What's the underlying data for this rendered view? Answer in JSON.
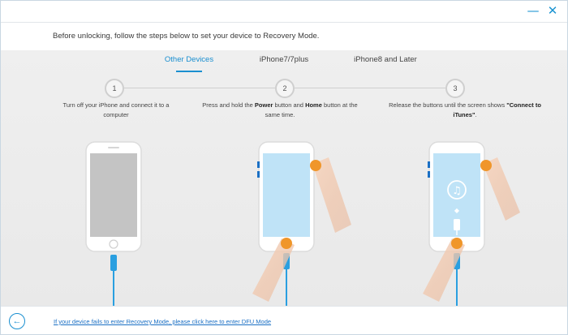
{
  "window": {
    "minimize_glyph": "—",
    "close_glyph": "✕"
  },
  "header": {
    "instruction": "Before unlocking, follow the steps below to set your device to Recovery Mode."
  },
  "tabs": [
    {
      "label": "Other Devices",
      "active": true
    },
    {
      "label": "iPhone7/7plus",
      "active": false
    },
    {
      "label": "iPhone8 and Later",
      "active": false
    }
  ],
  "steps": [
    {
      "number": "1",
      "text_1": "Turn off your iPhone and connect it to a computer"
    },
    {
      "number": "2",
      "text_1": "Press and hold the ",
      "bold_1": "Power",
      "text_2": " button and ",
      "bold_2": "Home",
      "text_3": " button at the same time."
    },
    {
      "number": "3",
      "text_1": "Release the buttons until the screen shows ",
      "bold_1": "\"Connect to iTunes\"",
      "text_2": "."
    }
  ],
  "footer": {
    "back_glyph": "←",
    "dfu_link": "If your device fails to enter Recovery Mode, please click here to enter DFU Mode"
  },
  "colors": {
    "accent": "#1a8fd0",
    "finger_tip": "#f0962a",
    "screen_blue": "#bfe3f7",
    "screen_gray": "#c4c4c4",
    "cable": "#2a9fe0"
  },
  "icons": [
    "minimize-icon",
    "close-icon",
    "itunes-music-note-icon",
    "lightning-cable-icon",
    "back-arrow-icon"
  ]
}
